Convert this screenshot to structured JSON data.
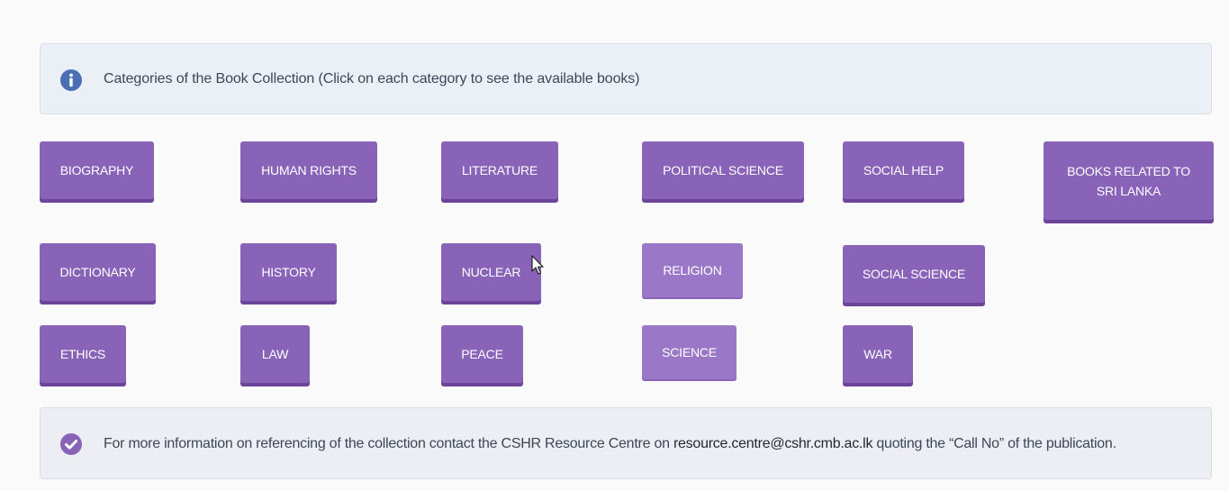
{
  "info": {
    "icon": "info-circle-icon",
    "text": "Categories of the Book Collection (Click on each category to see the available books)",
    "icon_color": "#4a6fb5"
  },
  "categories": [
    {
      "label": "BIOGRAPHY"
    },
    {
      "label": "HUMAN RIGHTS"
    },
    {
      "label": "LITERATURE"
    },
    {
      "label": "POLITICAL SCIENCE"
    },
    {
      "label": "SOCIAL HELP"
    },
    {
      "label": "BOOKS RELATED TO\nSRI LANKA"
    },
    {
      "label": "DICTIONARY"
    },
    {
      "label": "HISTORY"
    },
    {
      "label": "NUCLEAR"
    },
    {
      "label": "RELIGION"
    },
    {
      "label": "SOCIAL SCIENCE"
    },
    {
      "label": "ETHICS"
    },
    {
      "label": "LAW"
    },
    {
      "label": "PEACE"
    },
    {
      "label": "SCIENCE"
    },
    {
      "label": "WAR"
    }
  ],
  "footer": {
    "icon": "check-circle-icon",
    "text_before": "For more information on referencing of the collection contact the CSHR Resource Centre on ",
    "email": "resource.centre@cshr.cmb.ac.lk",
    "text_after": " quoting the “Call No” of the publication.",
    "icon_color": "#8863b8"
  },
  "colors": {
    "button": "#8863b8",
    "button_shadow": "#6c4598",
    "button_pale": "#9a78c7",
    "info_bg": "#ebf0f7",
    "footer_bg": "#eceef3"
  }
}
